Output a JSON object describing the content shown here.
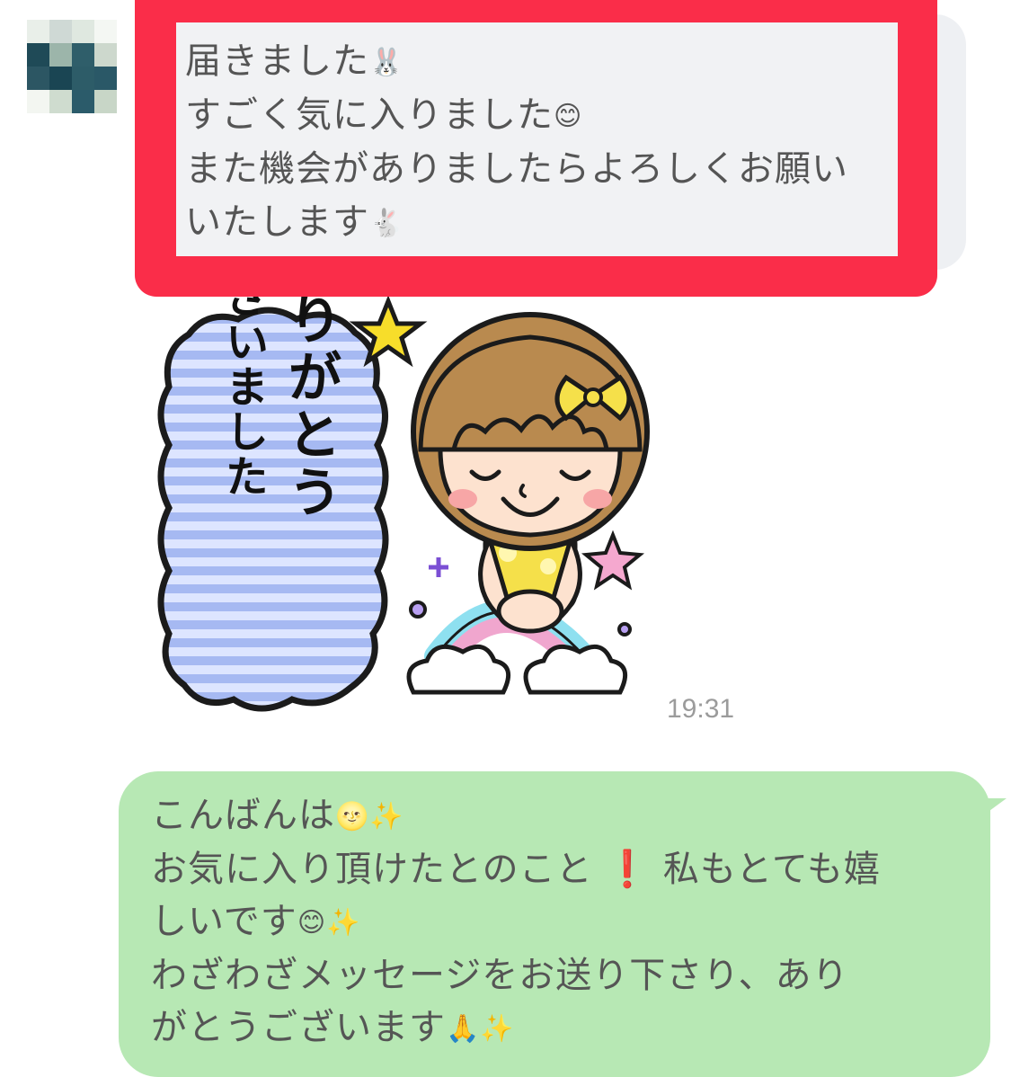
{
  "incoming": {
    "lines": [
      "届きました",
      "すごく気に入りました",
      "また機会がありましたらよろしくお願い",
      "いたします"
    ]
  },
  "sticker": {
    "line1": "ありがとう",
    "line2": "ございました"
  },
  "timestamp": "19:31",
  "outgoing": {
    "line1": "こんばんは",
    "line2a": "お気に入り頂けたとのこと",
    "line2b": "私もとても嬉",
    "line3": "しいです",
    "line4": "わざわざメッセージをお送り下さり、あり",
    "line5": "がとうございます"
  },
  "colors": {
    "highlight": "#fa2d49",
    "outgoing_bubble": "#b7e8b4",
    "incoming_bubble": "#eef0f3"
  }
}
